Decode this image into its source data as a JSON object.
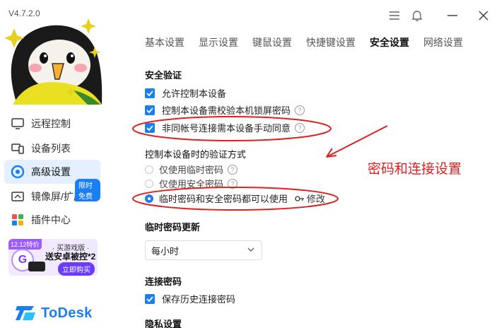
{
  "app": {
    "version": "V4.7.2.0",
    "logo_text": "ToDesk"
  },
  "sidebar": {
    "items": [
      {
        "label": "远程控制",
        "icon": "monitor-icon"
      },
      {
        "label": "设备列表",
        "icon": "devices-icon"
      },
      {
        "label": "高级设置",
        "icon": "gear-icon",
        "active": true
      },
      {
        "label": "镜像屏/扩展屏",
        "icon": "mirror-screen-icon",
        "badge": "限时免费"
      },
      {
        "label": "插件中心",
        "icon": "plugins-icon"
      }
    ],
    "promo": {
      "tag": "12.12特价",
      "line1": "· 买游戏版 ·",
      "line2": "送安卓被控*2",
      "button": "立即购买",
      "badge_letter": "G"
    }
  },
  "tabs": [
    "基本设置",
    "显示设置",
    "键鼠设置",
    "快捷键设置",
    "安全设置",
    "网络设置"
  ],
  "active_tab": "安全设置",
  "security": {
    "title": "安全验证",
    "checks": [
      {
        "label": "允许控制本设备",
        "checked": true,
        "help": false
      },
      {
        "label": "控制本设备需校验本机锁屏密码",
        "checked": true,
        "help": true
      },
      {
        "label": "非同帐号连接需本设备手动同意",
        "checked": true,
        "help": true
      }
    ]
  },
  "verification": {
    "title": "控制本设备时的验证方式",
    "options": [
      {
        "label": "仅使用临时密码",
        "selected": false,
        "help": true
      },
      {
        "label": "仅使用安全密码",
        "selected": false,
        "help": true
      },
      {
        "label": "临时密码和安全密码都可以使用",
        "selected": true,
        "help": false
      }
    ],
    "modify_label": "修改"
  },
  "temp_password": {
    "title": "临时密码更新",
    "value": "每小时"
  },
  "connection_password": {
    "title": "连接密码",
    "save_label": "保存历史连接密码",
    "checked": true
  },
  "privacy": {
    "title": "隐私设置"
  },
  "annotation": {
    "text": "密码和连接设置",
    "color": "#e02020"
  },
  "colors": {
    "accent": "#1a7ef5",
    "active_bg": "#e4efff"
  }
}
